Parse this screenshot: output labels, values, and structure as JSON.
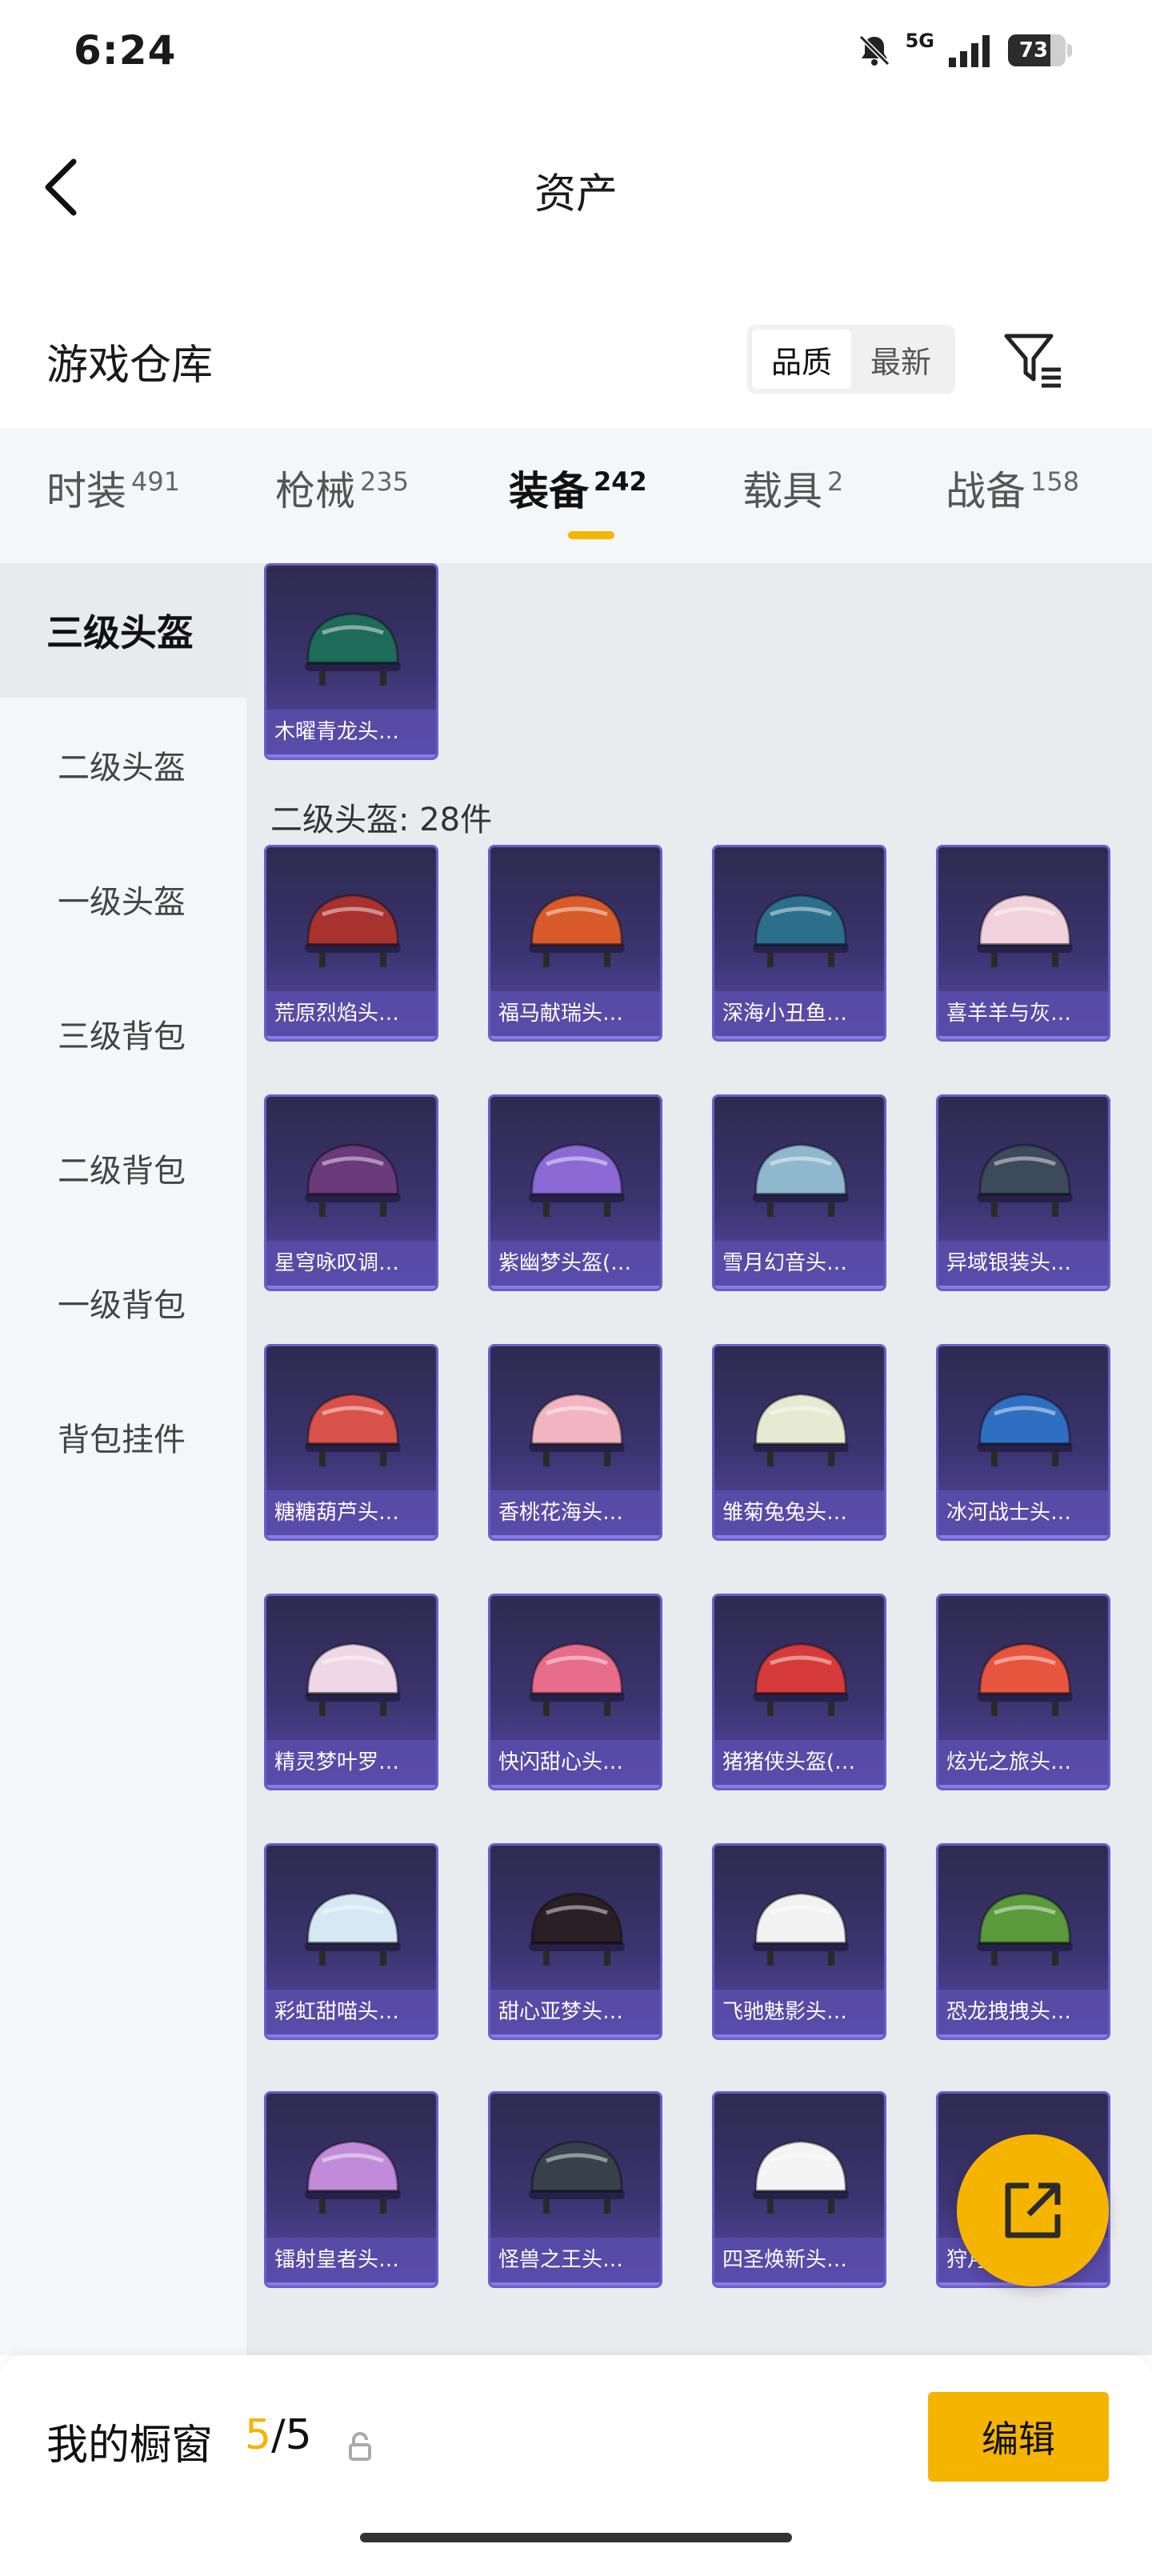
{
  "status": {
    "time": "6:24",
    "network": "5G",
    "battery": "73",
    "battery_level": 0.73
  },
  "header": {
    "title": "资产"
  },
  "section": {
    "title": "游戏仓库",
    "sort": [
      "品质",
      "最新"
    ]
  },
  "tabs": [
    {
      "label": "时装",
      "count": "491"
    },
    {
      "label": "枪械",
      "count": "235"
    },
    {
      "label": "装备",
      "count": "242"
    },
    {
      "label": "载具",
      "count": "2"
    },
    {
      "label": "战备",
      "count": "158"
    }
  ],
  "sidebar": [
    "三级头盔",
    "二级头盔",
    "一级头盔",
    "三级背包",
    "二级背包",
    "一级背包",
    "背包挂件"
  ],
  "level3_items": [
    "木曜青龙头…"
  ],
  "group_heading": "二级头盔: 28件",
  "level2_items": [
    "荒原烈焰头…",
    "福马献瑞头…",
    "深海小丑鱼…",
    "喜羊羊与灰…",
    "星穹咏叹调…",
    "紫幽梦头盔(…",
    "雪月幻音头…",
    "异域银装头…",
    "糖糖葫芦头…",
    "香桃花海头…",
    "雏菊兔兔头…",
    "冰河战士头…",
    "精灵梦叶罗…",
    "快闪甜心头…",
    "猪猪侠头盔(…",
    "炫光之旅头…",
    "彩虹甜喵头…",
    "甜心亚梦头…",
    "飞驰魅影头…",
    "恐龙拽拽头…",
    "镭射皇者头…",
    "怪兽之王头…",
    "四圣焕新头…",
    "狩月元帅头…"
  ],
  "helmet_colors": [
    "#1f6b5a",
    "#a8322e",
    "#d85a2a",
    "#2b6f8c",
    "#f1d2dc",
    "#6b3a7a",
    "#8b6ad6",
    "#8fb8cf",
    "#3c4a5c",
    "#d8524a",
    "#f2b5c0",
    "#e6ead2",
    "#2f6fc2",
    "#efd7e6",
    "#e86d8a",
    "#d63a3a",
    "#e8553e",
    "#d5e8f4",
    "#2a1f25",
    "#f2f2f2",
    "#5a9a3a",
    "#c28bd9",
    "#37414c",
    "#f4f4f4",
    "#3b3a6a"
  ],
  "showcase": {
    "label": "我的橱窗",
    "current": "5",
    "total": "/5",
    "edit": "编辑"
  }
}
